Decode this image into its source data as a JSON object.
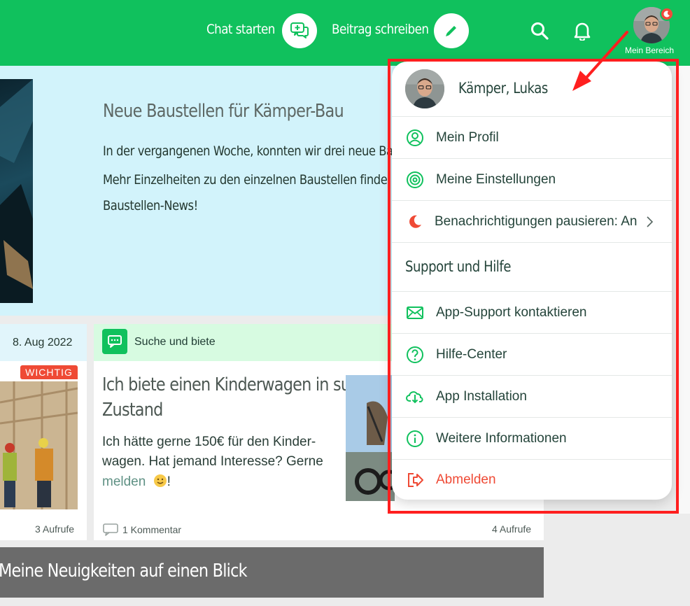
{
  "topbar": {
    "chat_label": "Chat starten",
    "post_label": "Beitrag schreiben",
    "mein_bereich": "Mein Bereich",
    "search_icon": "search-icon",
    "bell_icon": "bell-icon",
    "accent": "#10c15d"
  },
  "hero": {
    "title": "Neue Baustellen für Kämper-Bau",
    "line1": "In der vergangenen Woche, konnten wir drei neue Ba",
    "line2": "Mehr Einzelheiten zu den einzelnen Baustellen finde",
    "line3": "Baustellen-News!"
  },
  "card_left": {
    "date": "8. Aug 2022",
    "badge": "WICHTIG",
    "views": "3 Aufrufe"
  },
  "card_mid": {
    "category": "Suche und biete",
    "title_line1": "Ich biete einen Kinderwagen in super",
    "title_line2": "Zustand",
    "text_line1": "Ich hätte gerne 150€ für den Kinder-",
    "text_line2": "wagen. Hat jemand Interesse? Gerne",
    "text_line3_link": "melden",
    "text_line3_rest": "!",
    "comments": "1 Kommentar",
    "views": "4 Aufrufe"
  },
  "section_banner": {
    "title": "Meine Neuigkeiten auf einen Blick"
  },
  "dropdown": {
    "user_name": "Kämper, Lukas",
    "items": [
      {
        "label": "Mein Profil",
        "icon": "profile-icon"
      },
      {
        "label": "Meine Einstellungen",
        "icon": "gear-icon"
      },
      {
        "label": "Benachrichtigungen pausieren: An",
        "icon": "moon-icon"
      }
    ],
    "section_title": "Support und Hilfe",
    "support_items": [
      {
        "label": "App-Support kontaktieren",
        "icon": "mail-icon"
      },
      {
        "label": "Hilfe-Center",
        "icon": "help-icon"
      },
      {
        "label": "App Installation",
        "icon": "cloud-download-icon"
      },
      {
        "label": "Weitere Informationen",
        "icon": "info-icon"
      }
    ],
    "logout": {
      "label": "Abmelden",
      "icon": "logout-icon"
    },
    "danger_color": "#ef4a35"
  },
  "annotation": {
    "box_color": "#ff1f1f"
  }
}
